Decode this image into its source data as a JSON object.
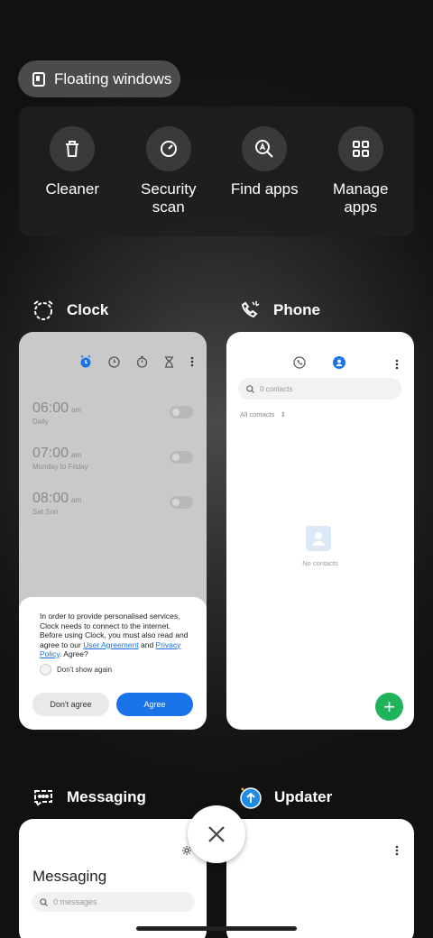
{
  "floating_windows": {
    "label": "Floating windows",
    "icon": "floating-window-icon"
  },
  "tools": [
    {
      "label": "Cleaner",
      "icon": "trash-icon"
    },
    {
      "label": "Security scan",
      "icon": "security-scan-icon"
    },
    {
      "label": "Find apps",
      "icon": "find-apps-icon"
    },
    {
      "label": "Manage apps",
      "icon": "grid-apps-icon"
    }
  ],
  "clock": {
    "app_name": "Clock",
    "alarms": [
      {
        "time": "06:00",
        "ampm": "am",
        "repeat": "Daily"
      },
      {
        "time": "07:00",
        "ampm": "am",
        "repeat": "Monday to Friday"
      },
      {
        "time": "08:00",
        "ampm": "am",
        "repeat": "Sat Sun"
      }
    ],
    "dialog": {
      "message_before": "In order to provide personalised services, Clock needs to connect to the internet. Before using Clock, you must also read and agree to our ",
      "link_user_agreement": "User Agreement",
      "and_text": " and ",
      "link_privacy_policy": "Privacy Policy",
      "message_after": ". Agree?",
      "dont_show_again": "Don't show again",
      "dont_agree": "Don't agree",
      "agree": "Agree"
    }
  },
  "phone": {
    "app_name": "Phone",
    "search_placeholder": "0 contacts",
    "filter": "All contacts",
    "empty": "No contacts",
    "fab": "+"
  },
  "messaging": {
    "app_name": "Messaging",
    "title": "Messaging",
    "search_placeholder": "0 messages"
  },
  "updater": {
    "app_name": "Updater"
  },
  "colors": {
    "accent_blue": "#1a73e8",
    "fab_green": "#1fb35c"
  }
}
